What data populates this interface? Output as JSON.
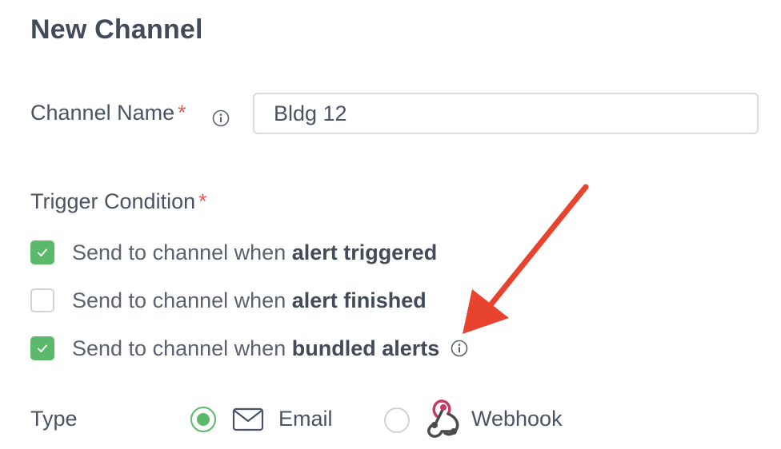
{
  "page": {
    "title": "New Channel"
  },
  "channel_name": {
    "label": "Channel Name",
    "required_mark": "*",
    "value": "Bldg 12",
    "info_icon": "info-circle-icon"
  },
  "trigger": {
    "label": "Trigger Condition",
    "required_mark": "*",
    "options": [
      {
        "prefix": "Send to channel when ",
        "emphasis": "alert triggered",
        "checked": true
      },
      {
        "prefix": "Send to channel when ",
        "emphasis": "alert finished",
        "checked": false
      },
      {
        "prefix": "Send to channel when ",
        "emphasis": "bundled alerts",
        "checked": true
      }
    ]
  },
  "type": {
    "label": "Type",
    "options": [
      {
        "label": "Email",
        "icon": "envelope-icon",
        "selected": true
      },
      {
        "label": "Webhook",
        "icon": "webhook-icon",
        "selected": false
      }
    ]
  },
  "colors": {
    "accent_green": "#5cb86a",
    "required_red": "#e35d5d",
    "annotation_arrow": "#e8432e"
  }
}
